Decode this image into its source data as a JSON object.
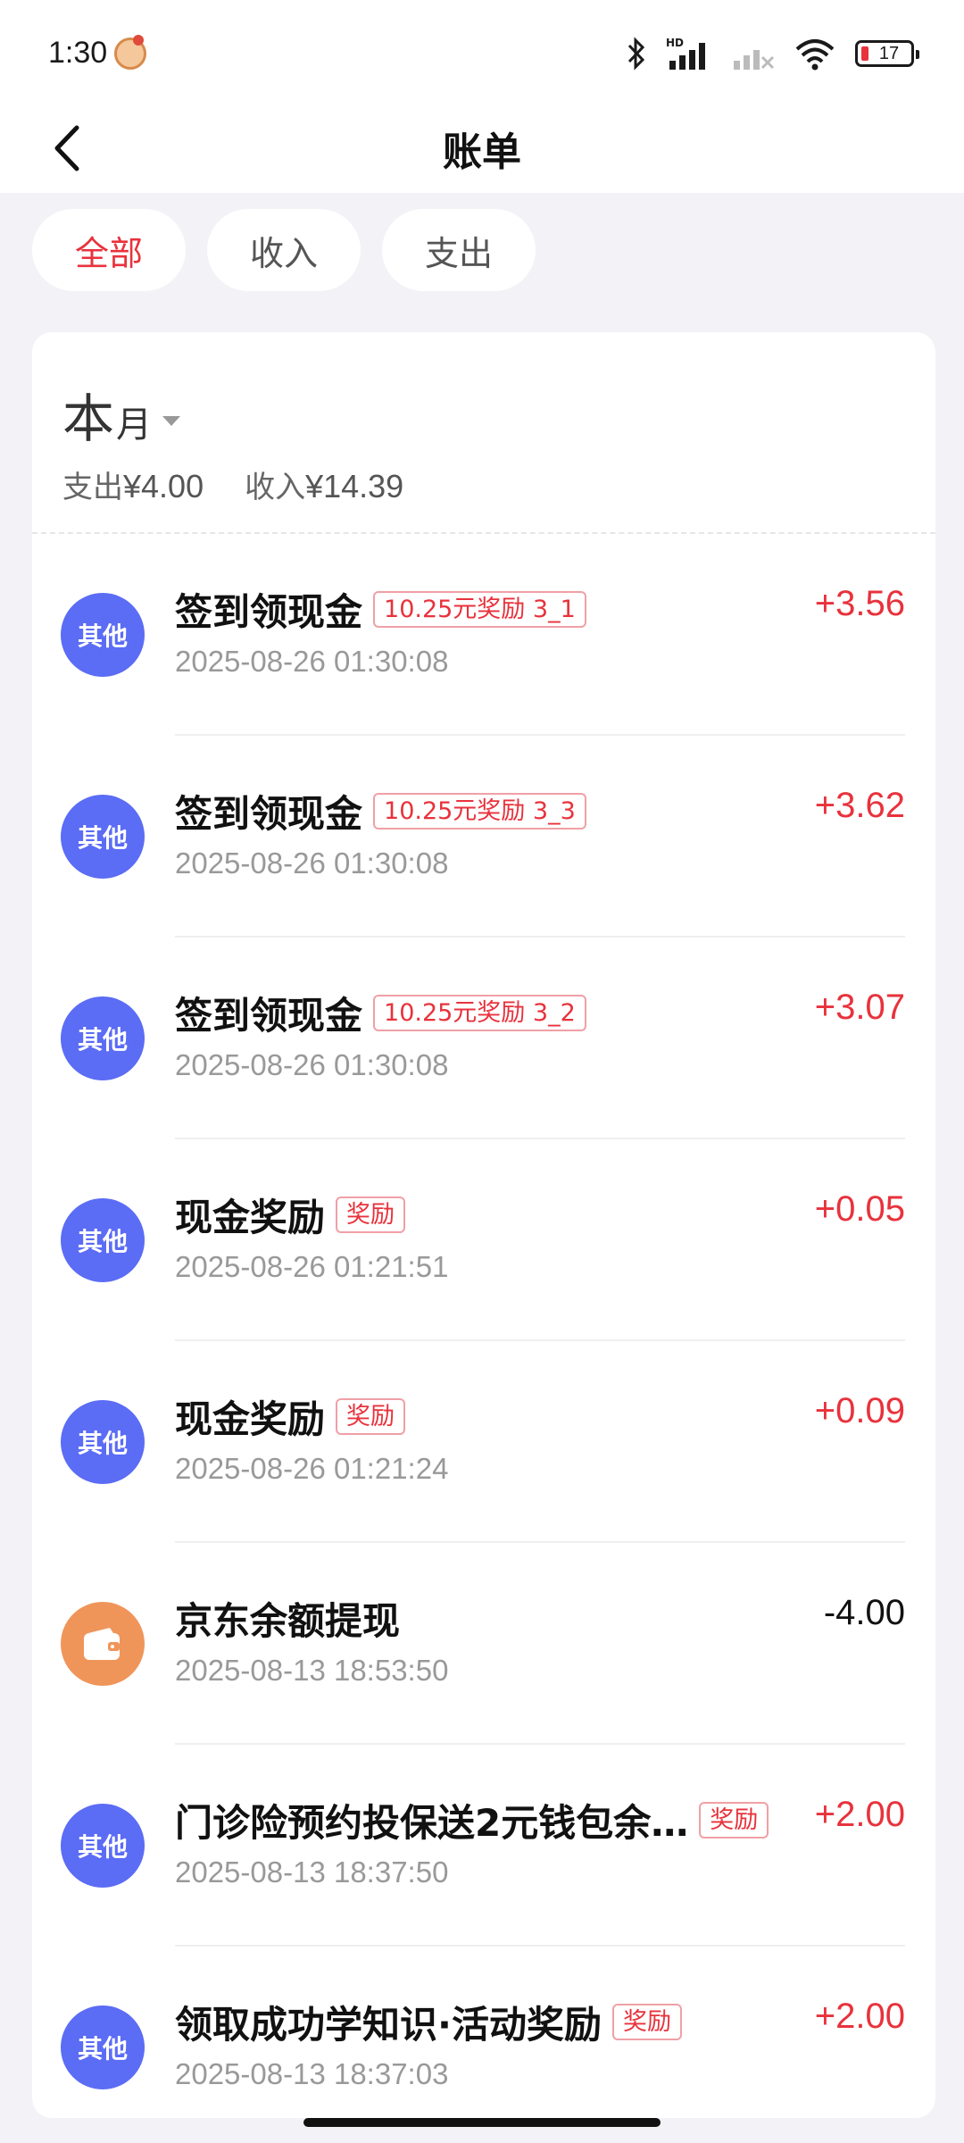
{
  "status_bar": {
    "time": "1:30",
    "battery": "17",
    "network_label": "HD"
  },
  "nav": {
    "title": "账单"
  },
  "tabs": [
    {
      "label": "全部",
      "active": true
    },
    {
      "label": "收入",
      "active": false
    },
    {
      "label": "支出",
      "active": false
    }
  ],
  "period": {
    "big": "本",
    "small": "月",
    "expense_label": "支出",
    "expense_value": "¥4.00",
    "income_label": "收入",
    "income_value": "¥14.39"
  },
  "transactions": [
    {
      "avatar": "其他",
      "title": "签到领现金",
      "tag": "10.25元奖励 3_1",
      "date": "2025-08-26 01:30:08",
      "amount": "+3.56"
    },
    {
      "avatar": "其他",
      "title": "签到领现金",
      "tag": "10.25元奖励 3_3",
      "date": "2025-08-26 01:30:08",
      "amount": "+3.62"
    },
    {
      "avatar": "其他",
      "title": "签到领现金",
      "tag": "10.25元奖励 3_2",
      "date": "2025-08-26 01:30:08",
      "amount": "+3.07"
    },
    {
      "avatar": "其他",
      "title": "现金奖励",
      "tag": "奖励",
      "date": "2025-08-26 01:21:51",
      "amount": "+0.05"
    },
    {
      "avatar": "其他",
      "title": "现金奖励",
      "tag": "奖励",
      "date": "2025-08-26 01:21:24",
      "amount": "+0.09"
    },
    {
      "avatar": "",
      "icon": "wallet-icon",
      "title": "京东余额提现",
      "tag": "",
      "date": "2025-08-13 18:53:50",
      "amount": "-4.00"
    },
    {
      "avatar": "其他",
      "title": "门诊险预约投保送2元钱包余…",
      "tag": "奖励",
      "date": "2025-08-13 18:37:50",
      "amount": "+2.00"
    },
    {
      "avatar": "其他",
      "title": "领取成功学知识·活动奖励",
      "tag": "奖励",
      "date": "2025-08-13 18:37:03",
      "amount": "+2.00"
    }
  ],
  "colors": {
    "accent_red": "#e8323c",
    "avatar_blue": "#5b6cf5",
    "avatar_orange": "#f0955a"
  }
}
